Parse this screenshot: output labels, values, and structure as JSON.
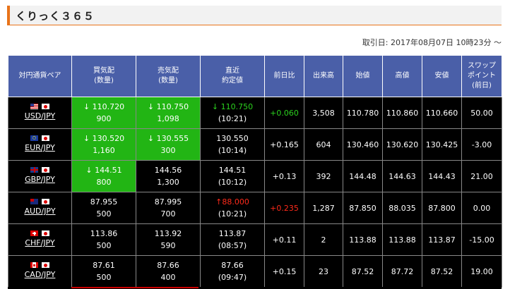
{
  "page_title": "くりっく３６５",
  "date_line": "取引日: 2017年08月07日 10時23分 〜",
  "headers": {
    "pair": "対円通貨ペア",
    "bid_1": "買気配",
    "bid_2": "(数量)",
    "ask_1": "売気配",
    "ask_2": "(数量)",
    "last_1": "直近",
    "last_2": "約定値",
    "change": "前日比",
    "volume": "出来高",
    "open": "始値",
    "high": "高値",
    "low": "安値",
    "swap_1": "スワップ",
    "swap_2": "ポイント",
    "swap_3": "(前日)"
  },
  "rows": [
    {
      "flag": "us",
      "pair": "USD/JPY",
      "bid": "110.720",
      "bid_qty": "900",
      "ask": "110.750",
      "ask_qty": "1,098",
      "last": "110.750",
      "last_time": "(10:21)",
      "change": "+0.060",
      "volume": "3,508",
      "open": "110.780",
      "high": "110.860",
      "low": "110.660",
      "swap": "50.00"
    },
    {
      "flag": "eu",
      "pair": "EUR/JPY",
      "bid": "130.520",
      "bid_qty": "1,160",
      "ask": "130.555",
      "ask_qty": "300",
      "last": "130.550",
      "last_time": "(10:14)",
      "change": "+0.165",
      "volume": "604",
      "open": "130.460",
      "high": "130.620",
      "low": "130.425",
      "swap": "-3.00"
    },
    {
      "flag": "gb",
      "pair": "GBP/JPY",
      "bid": "144.51",
      "bid_qty": "800",
      "ask": "144.56",
      "ask_qty": "1,300",
      "last": "144.51",
      "last_time": "(10:12)",
      "change": "+0.13",
      "volume": "392",
      "open": "144.48",
      "high": "144.63",
      "low": "144.43",
      "swap": "21.00"
    },
    {
      "flag": "au",
      "pair": "AUD/JPY",
      "bid": "87.955",
      "bid_qty": "500",
      "ask": "87.995",
      "ask_qty": "700",
      "last": "88.000",
      "last_time": "(10:21)",
      "change": "+0.235",
      "volume": "1,287",
      "open": "87.850",
      "high": "88.035",
      "low": "87.800",
      "swap": "0.00"
    },
    {
      "flag": "ch",
      "pair": "CHF/JPY",
      "bid": "113.86",
      "bid_qty": "500",
      "ask": "113.92",
      "ask_qty": "590",
      "last": "113.87",
      "last_time": "(08:57)",
      "change": "+0.11",
      "volume": "2",
      "open": "113.88",
      "high": "113.88",
      "low": "113.87",
      "swap": "-15.00"
    },
    {
      "flag": "ca",
      "pair": "CAD/JPY",
      "bid": "87.61",
      "bid_qty": "500",
      "ask": "87.66",
      "ask_qty": "400",
      "last": "87.66",
      "last_time": "(09:47)",
      "change": "+0.15",
      "volume": "23",
      "open": "87.52",
      "high": "87.72",
      "low": "87.52",
      "swap": "19.00"
    }
  ],
  "colors": {
    "header_bg": "#4a5fa8",
    "accent_orange": "#e8731a",
    "highlight_green": "#22b514",
    "up_green": "#2bd11e",
    "up_red": "#ff2a1a"
  }
}
